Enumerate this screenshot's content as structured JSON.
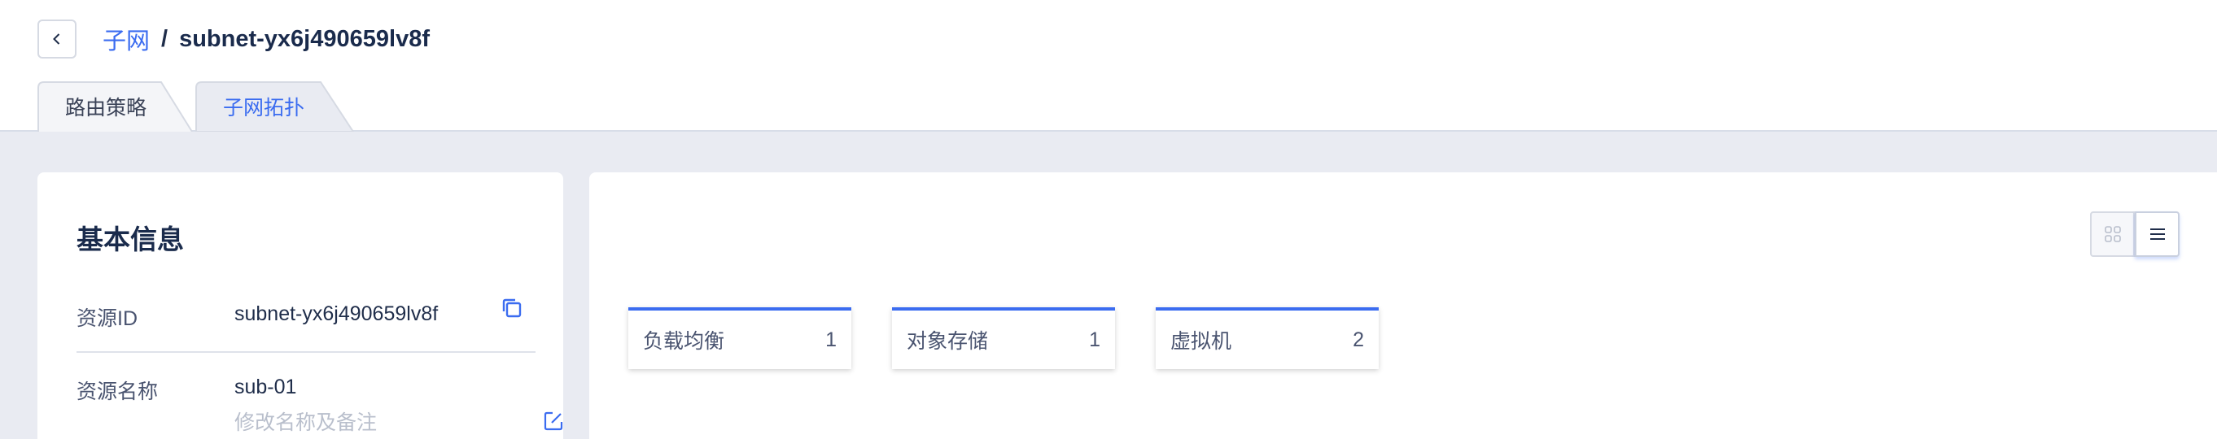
{
  "breadcrumb": {
    "parent": "子网",
    "separator": "/",
    "current": "subnet-yx6j490659lv8f"
  },
  "tabs": [
    {
      "label": "路由策略",
      "active": false
    },
    {
      "label": "子网拓扑",
      "active": true
    }
  ],
  "basic_info": {
    "title": "基本信息",
    "resource_id_label": "资源ID",
    "resource_id": "subnet-yx6j490659lv8f",
    "resource_name_label": "资源名称",
    "resource_name": "sub-01",
    "remark_placeholder": "修改名称及备注"
  },
  "view_toggle": {
    "selected": "list"
  },
  "resources": [
    {
      "label": "负载均衡",
      "count": "1"
    },
    {
      "label": "对象存储",
      "count": "1"
    },
    {
      "label": "虚拟机",
      "count": "2"
    }
  ],
  "colors": {
    "accent": "#3b6cf0",
    "background": "#e9ebf2",
    "text": "#1f2d4a"
  },
  "icons": [
    "back-arrow-icon",
    "copy-icon",
    "edit-icon",
    "grid-view-icon",
    "list-view-icon"
  ]
}
